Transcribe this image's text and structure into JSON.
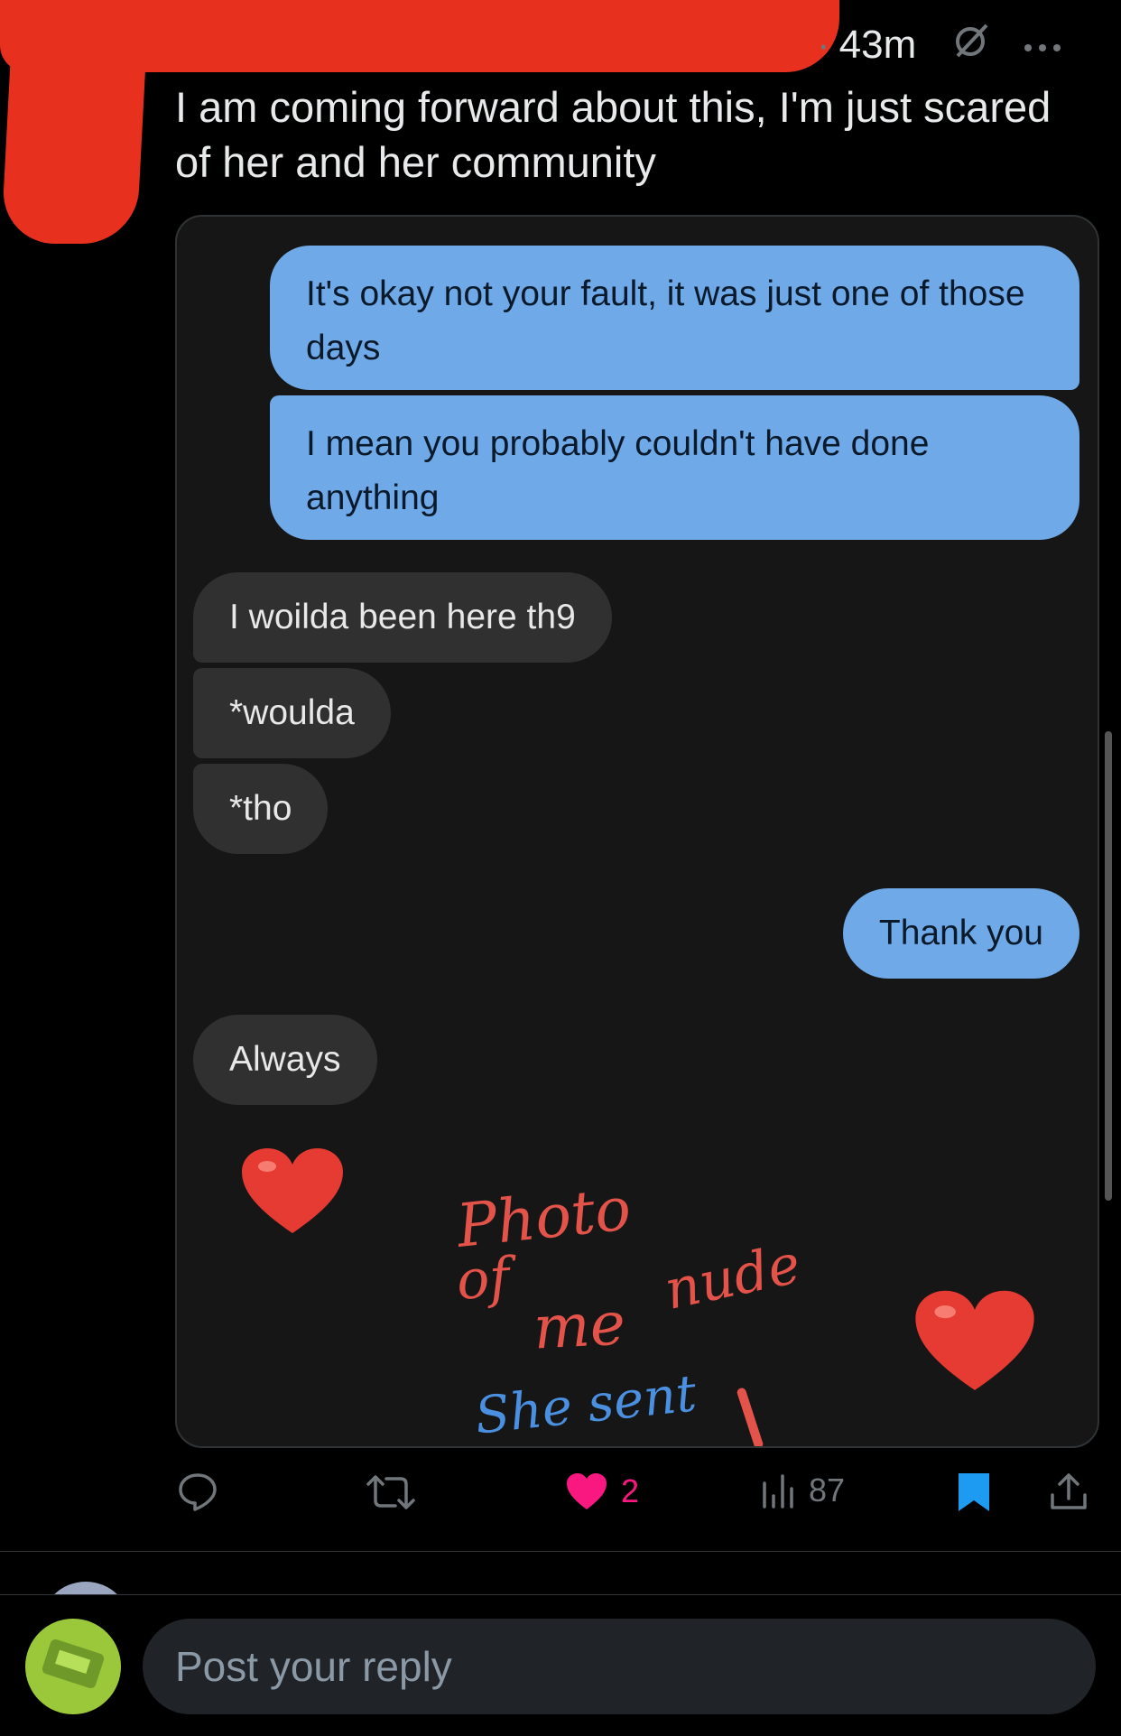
{
  "post": {
    "age": "43m",
    "dot": "·",
    "text": "I am coming forward about this, I'm just scared of her and her community"
  },
  "conversation": {
    "outgoing_1": "It's okay not your fault, it was just one of those days",
    "outgoing_2": "I mean you probably couldn't have done anything",
    "incoming_1": "I woilda been here th9",
    "incoming_2": "*woulda",
    "incoming_3": "*tho",
    "outgoing_3": "Thank you",
    "incoming_4": "Always",
    "heart_emoji": "❤️"
  },
  "annotations": {
    "line_1": "Photo",
    "line_2": "of",
    "line_3": "me",
    "line_4": "nude",
    "line_5": "She sent",
    "colors": {
      "red": "#e3534a",
      "blue": "#4a8fe0"
    }
  },
  "actions": {
    "likes": "2",
    "views": "87",
    "icons": [
      "reply-icon",
      "repost-icon",
      "heart-icon",
      "views-icon",
      "bookmark-icon",
      "share-icon"
    ]
  },
  "reply": {
    "placeholder": "Post your reply"
  },
  "colors": {
    "redaction": "#e8301f",
    "bubble_out": "#6fa9e7",
    "bubble_in": "#303030",
    "like": "#f91880",
    "bookmark": "#1d9bf0"
  }
}
